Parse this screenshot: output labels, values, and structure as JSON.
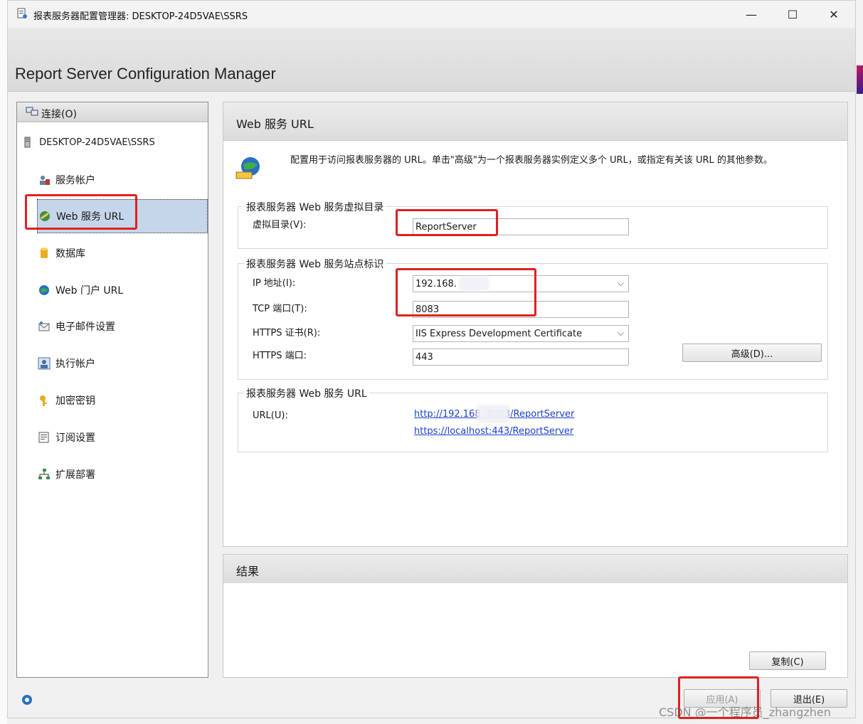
{
  "window": {
    "title": "报表服务器配置管理器: DESKTOP-24D5VAE\\SSRS",
    "minimize": "—",
    "maximize": "☐",
    "close": "✕"
  },
  "app": {
    "title": "Report Server Configuration Manager"
  },
  "nav": {
    "connect_label": "连接(O)",
    "server": "DESKTOP-24D5VAE\\SSRS",
    "items": [
      {
        "label": "服务帐户",
        "icon": "service-account-icon"
      },
      {
        "label": "Web 服务 URL",
        "icon": "web-service-icon",
        "selected": true
      },
      {
        "label": "数据库",
        "icon": "database-icon"
      },
      {
        "label": "Web 门户 URL",
        "icon": "globe-icon"
      },
      {
        "label": "电子邮件设置",
        "icon": "email-icon"
      },
      {
        "label": "执行帐户",
        "icon": "user-icon"
      },
      {
        "label": "加密密钥",
        "icon": "key-icon"
      },
      {
        "label": "订阅设置",
        "icon": "subscription-icon"
      },
      {
        "label": "扩展部署",
        "icon": "scale-out-icon"
      }
    ]
  },
  "main": {
    "header": "Web 服务 URL",
    "description": "配置用于访问报表服务器的 URL。单击\"高级\"为一个报表服务器实例定义多个 URL，或指定有关该 URL 的其他参数。",
    "vdir_group": {
      "legend": "报表服务器 Web 服务虚拟目录",
      "vdir_label": "虚拟目录(V):",
      "vdir_value": "ReportServer"
    },
    "site_group": {
      "legend": "报表服务器 Web 服务站点标识",
      "ip_label": "IP 地址(I):",
      "ip_value": "192.168.",
      "tcp_label": "TCP 端口(T):",
      "tcp_value": "8083",
      "https_cert_label": "HTTPS 证书(R):",
      "https_cert_value": "IIS Express Development Certificate",
      "https_port_label": "HTTPS 端口:",
      "https_port_value": "443",
      "advanced_button": "高级(D)..."
    },
    "url_group": {
      "legend": "报表服务器 Web 服务 URL",
      "url_label": "URL(U):",
      "url1": "http://192.168      :8083/ReportServer",
      "url2": "https://localhost:443/ReportServer"
    }
  },
  "results": {
    "header": "结果",
    "copy_button": "复制(C)"
  },
  "footer": {
    "apply_button": "应用(A)",
    "exit_button": "退出(E)",
    "watermark": "CSDN @一个程序员_zhangzhen"
  },
  "colors": {
    "selection": "#c5d5ea",
    "highlight_box": "#e02020",
    "link": "#1a3fd0"
  }
}
